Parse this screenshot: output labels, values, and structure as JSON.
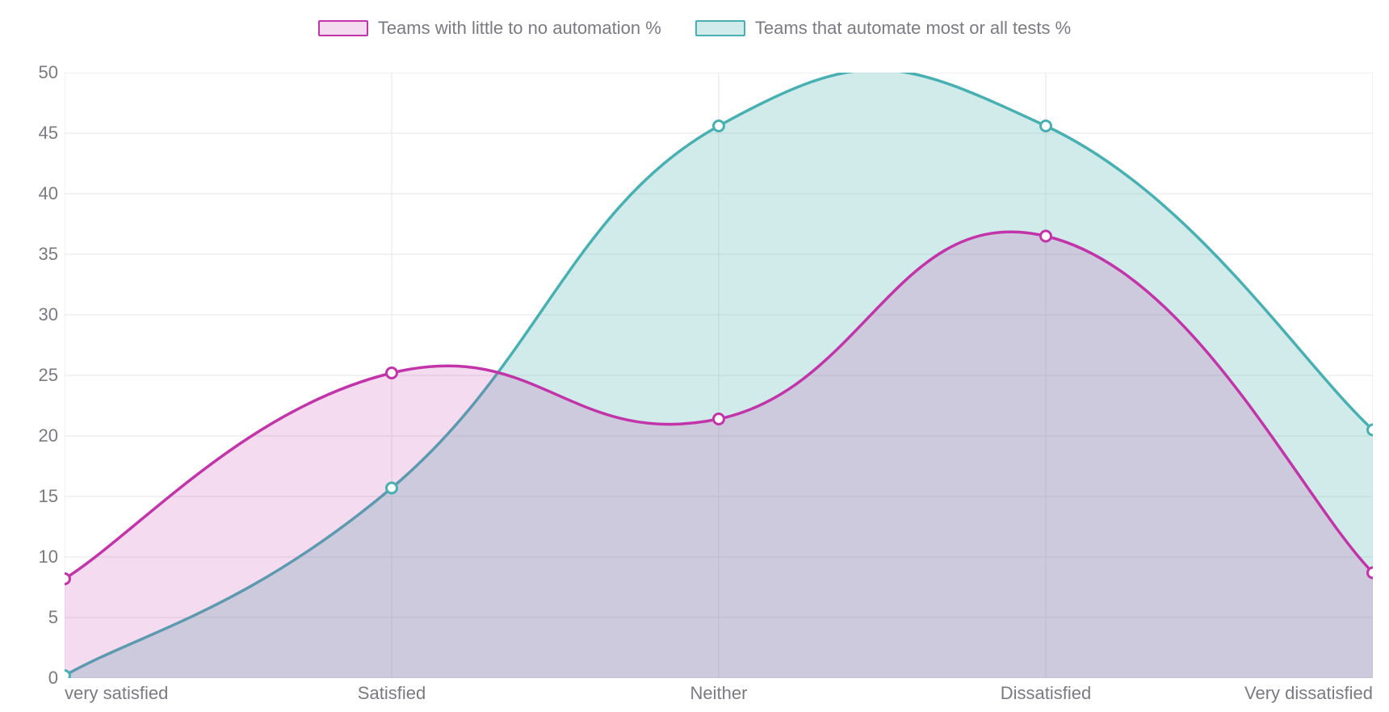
{
  "chart_data": {
    "type": "area",
    "categories": [
      "very satisfied",
      "Satisfied",
      "Neither",
      "Dissatisfied",
      "Very dissatisfied"
    ],
    "series": [
      {
        "name": "Teams with little to no automation %",
        "color": "#c235a9",
        "fill": "rgba(194,53,169,0.18)",
        "values": [
          8.2,
          25.2,
          21.4,
          36.5,
          8.7
        ]
      },
      {
        "name": "Teams that automate most or all tests %",
        "color": "#49b0b1",
        "fill": "rgba(73,176,177,0.25)",
        "values": [
          0.2,
          15.7,
          45.6,
          45.6,
          20.5
        ]
      }
    ],
    "ylim": [
      0,
      50
    ],
    "yticks": [
      0,
      5,
      10,
      15,
      20,
      25,
      30,
      35,
      40,
      45,
      50
    ],
    "xlabel": "",
    "ylabel": "",
    "title": "",
    "legend_position": "top",
    "grid": true,
    "smooth": true
  }
}
